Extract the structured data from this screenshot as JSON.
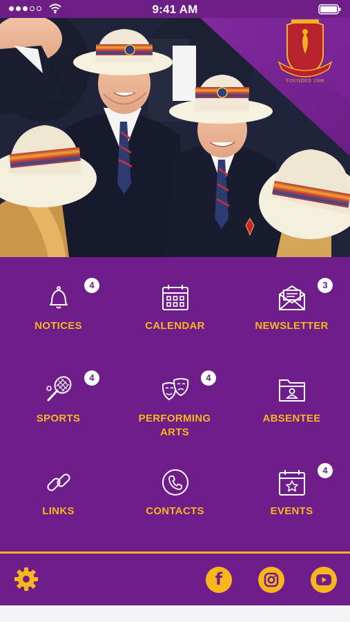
{
  "status_bar": {
    "time": "9:41 AM",
    "signal_bars_filled": 3,
    "signal_bars_total": 5
  },
  "header": {
    "crest_motto": "DEI LE FIDE",
    "founded": "FOUNDED 1908"
  },
  "theme": {
    "primary": "#6f1d8b",
    "accent": "#f8b61d",
    "badge_bg": "#ffffff"
  },
  "menu": {
    "tiles": [
      {
        "label": "NOTICES",
        "icon": "bell-icon",
        "badge": "4"
      },
      {
        "label": "CALENDAR",
        "icon": "calendar-icon",
        "badge": ""
      },
      {
        "label": "NEWSLETTER",
        "icon": "envelope-icon",
        "badge": "3"
      },
      {
        "label": "SPORTS",
        "icon": "tennis-racket-icon",
        "badge": "4"
      },
      {
        "label": "PERFORMING ARTS",
        "icon": "theatre-masks-icon",
        "badge": "4"
      },
      {
        "label": "ABSENTEE",
        "icon": "folder-person-icon",
        "badge": ""
      },
      {
        "label": "LINKS",
        "icon": "link-icon",
        "badge": ""
      },
      {
        "label": "CONTACTS",
        "icon": "phone-icon",
        "badge": ""
      },
      {
        "label": "EVENTS",
        "icon": "calendar-star-icon",
        "badge": "4"
      }
    ]
  },
  "footer": {
    "settings_icon": "gear-icon",
    "social": [
      {
        "name": "facebook",
        "icon": "facebook-icon",
        "glyph": "f"
      },
      {
        "name": "instagram",
        "icon": "instagram-icon"
      },
      {
        "name": "youtube",
        "icon": "youtube-icon"
      }
    ]
  }
}
